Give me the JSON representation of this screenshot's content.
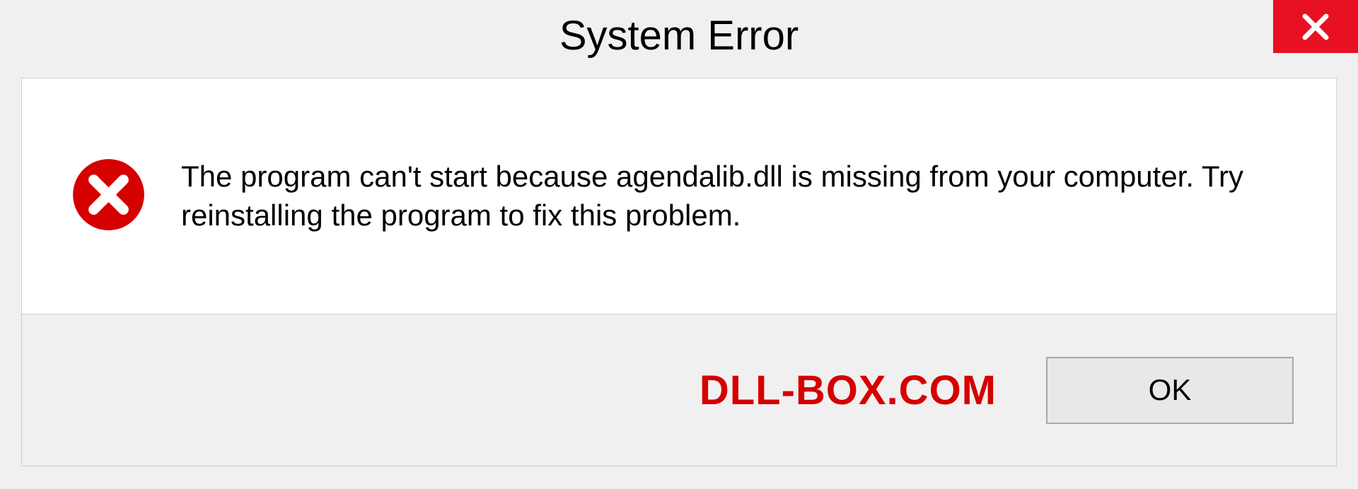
{
  "dialog": {
    "title": "System Error",
    "message": "The program can't start because agendalib.dll is missing from your computer. Try reinstalling the program to fix this problem.",
    "ok_label": "OK"
  },
  "watermark": "DLL-BOX.COM",
  "colors": {
    "close_button": "#e81123",
    "error_icon": "#d50000",
    "watermark": "#d50000"
  }
}
